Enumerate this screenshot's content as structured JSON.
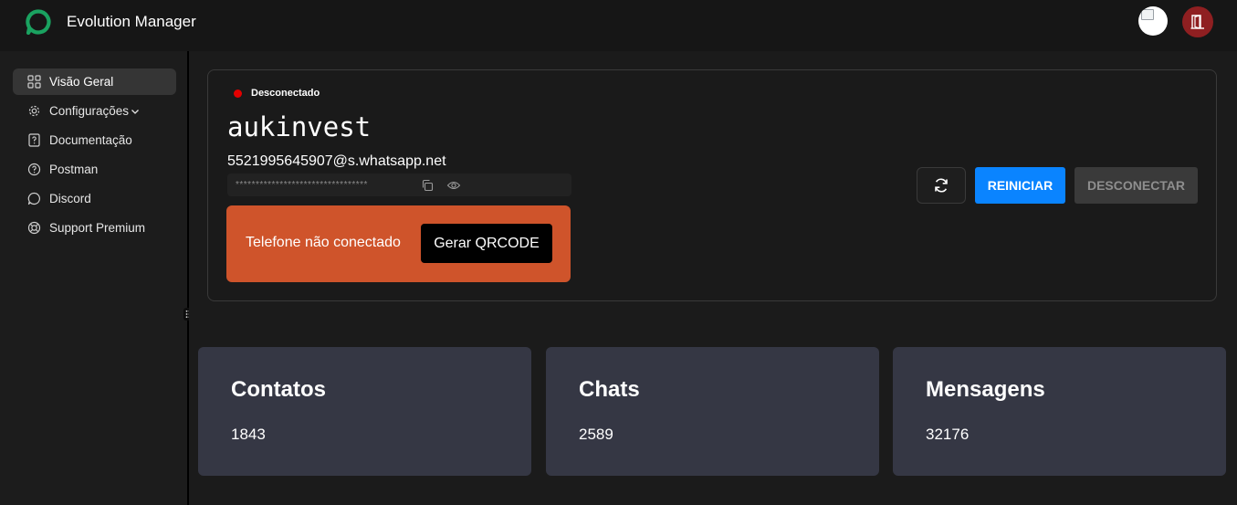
{
  "header": {
    "app_title": "Evolution Manager",
    "logo_icon": "chat-bubble-icon",
    "brand_color": "#1aa260",
    "logout_icon": "door-exit-icon"
  },
  "sidebar": {
    "items": [
      {
        "label": "Visão Geral",
        "icon": "grid-icon",
        "active": true
      },
      {
        "label": "Configurações",
        "icon": "gear-icon",
        "has_dropdown": true
      },
      {
        "label": "Documentação",
        "icon": "document-help-icon"
      },
      {
        "label": "Postman",
        "icon": "help-circle-icon"
      },
      {
        "label": "Discord",
        "icon": "chat-icon"
      },
      {
        "label": "Support Premium",
        "icon": "lifebuoy-icon"
      }
    ]
  },
  "instance": {
    "status": "Desconectado",
    "status_color": "#e30000",
    "name": "aukinvest",
    "owner_jid": "5521995645907@s.whatsapp.net",
    "token_masked": "*********************************",
    "alert_text": "Telefone não conectado",
    "alert_color": "#cf542b",
    "qr_button": "Gerar QRCODE",
    "restart_button": "REINICIAR",
    "disconnect_button": "DESCONECTAR"
  },
  "stats": [
    {
      "title": "Contatos",
      "value": "1843"
    },
    {
      "title": "Chats",
      "value": "2589"
    },
    {
      "title": "Mensagens",
      "value": "32176"
    }
  ]
}
